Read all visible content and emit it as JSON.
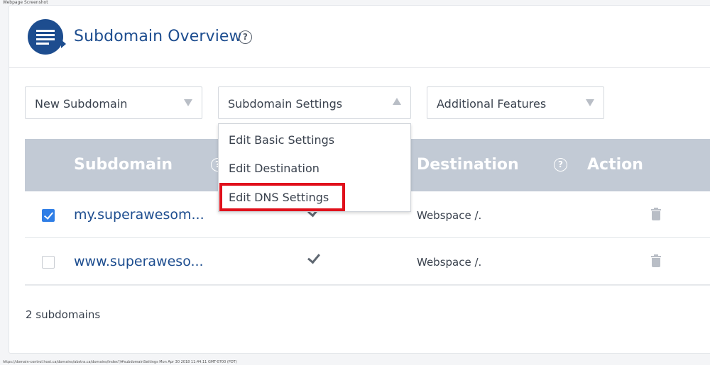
{
  "captions": {
    "top": "Webpage Screenshot",
    "bottom": "https://domain-control.host.ca/domains/abstra.ca/domains/index?/#subdomainSettings Mon Apr 30 2018 11:44:11 GMT-0700 (PDT)"
  },
  "header": {
    "title": "Subdomain Overview",
    "help_glyph": "?"
  },
  "toolbar": {
    "new_subdomain": "New Subdomain",
    "subdomain_settings": "Subdomain Settings",
    "additional_features": "Additional Features"
  },
  "settings_menu": {
    "items": [
      "Edit Basic Settings",
      "Edit Destination",
      "Edit DNS Settings"
    ]
  },
  "table": {
    "columns": {
      "subdomain": "Subdomain",
      "destination": "Destination",
      "action": "Action"
    },
    "rows": [
      {
        "name": "my.superawesom...",
        "selected": true,
        "destination": "Webspace /."
      },
      {
        "name": "www.superaweso...",
        "selected": false,
        "destination": "Webspace /."
      }
    ]
  },
  "footer": {
    "count": "2 subdomains"
  },
  "colors": {
    "accent": "#1d4d8f",
    "header_bg": "#c2cad5",
    "checkbox": "#2f7ee6",
    "highlight": "#e0101b"
  }
}
